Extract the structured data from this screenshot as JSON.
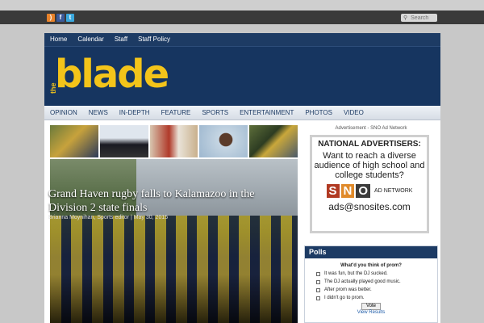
{
  "social": {
    "icons": [
      "rss-icon",
      "facebook-icon",
      "twitter-icon"
    ]
  },
  "search": {
    "placeholder": "Search"
  },
  "topnav": [
    "Home",
    "Calendar",
    "Staff",
    "Staff Policy"
  ],
  "logo": {
    "prefix": "the",
    "name": "blade"
  },
  "secnav": [
    "OPINION",
    "NEWS",
    "IN-DEPTH",
    "FEATURE",
    "SPORTS",
    "ENTERTAINMENT",
    "PHOTOS",
    "VIDEO"
  ],
  "featured": {
    "title": "Grand Haven rugby falls to Kalamazoo in the Division 2 state finals",
    "byline": "Brianna Moynihan, Sports editor | May 30, 2015"
  },
  "ad": {
    "label": "Advertisement - SNO Ad Network",
    "headline": "NATIONAL ADVERTISERS:",
    "body": "Want to reach a diverse audience of high school and college students?",
    "logo_letters": [
      "S",
      "N",
      "O"
    ],
    "logo_network": "AD NETWORK",
    "email": "ads@snosites.com"
  },
  "polls": {
    "title": "Polls",
    "question": "What'd you think of prom?",
    "options": [
      "It was fun, but the DJ sucked.",
      "The DJ actually played good music.",
      "After prom was better.",
      "I didn't go to prom."
    ],
    "vote_label": "Vote",
    "results_label": "View Results"
  },
  "colors": {
    "brand_navy": "#163560",
    "brand_yellow": "#f3c41a"
  }
}
